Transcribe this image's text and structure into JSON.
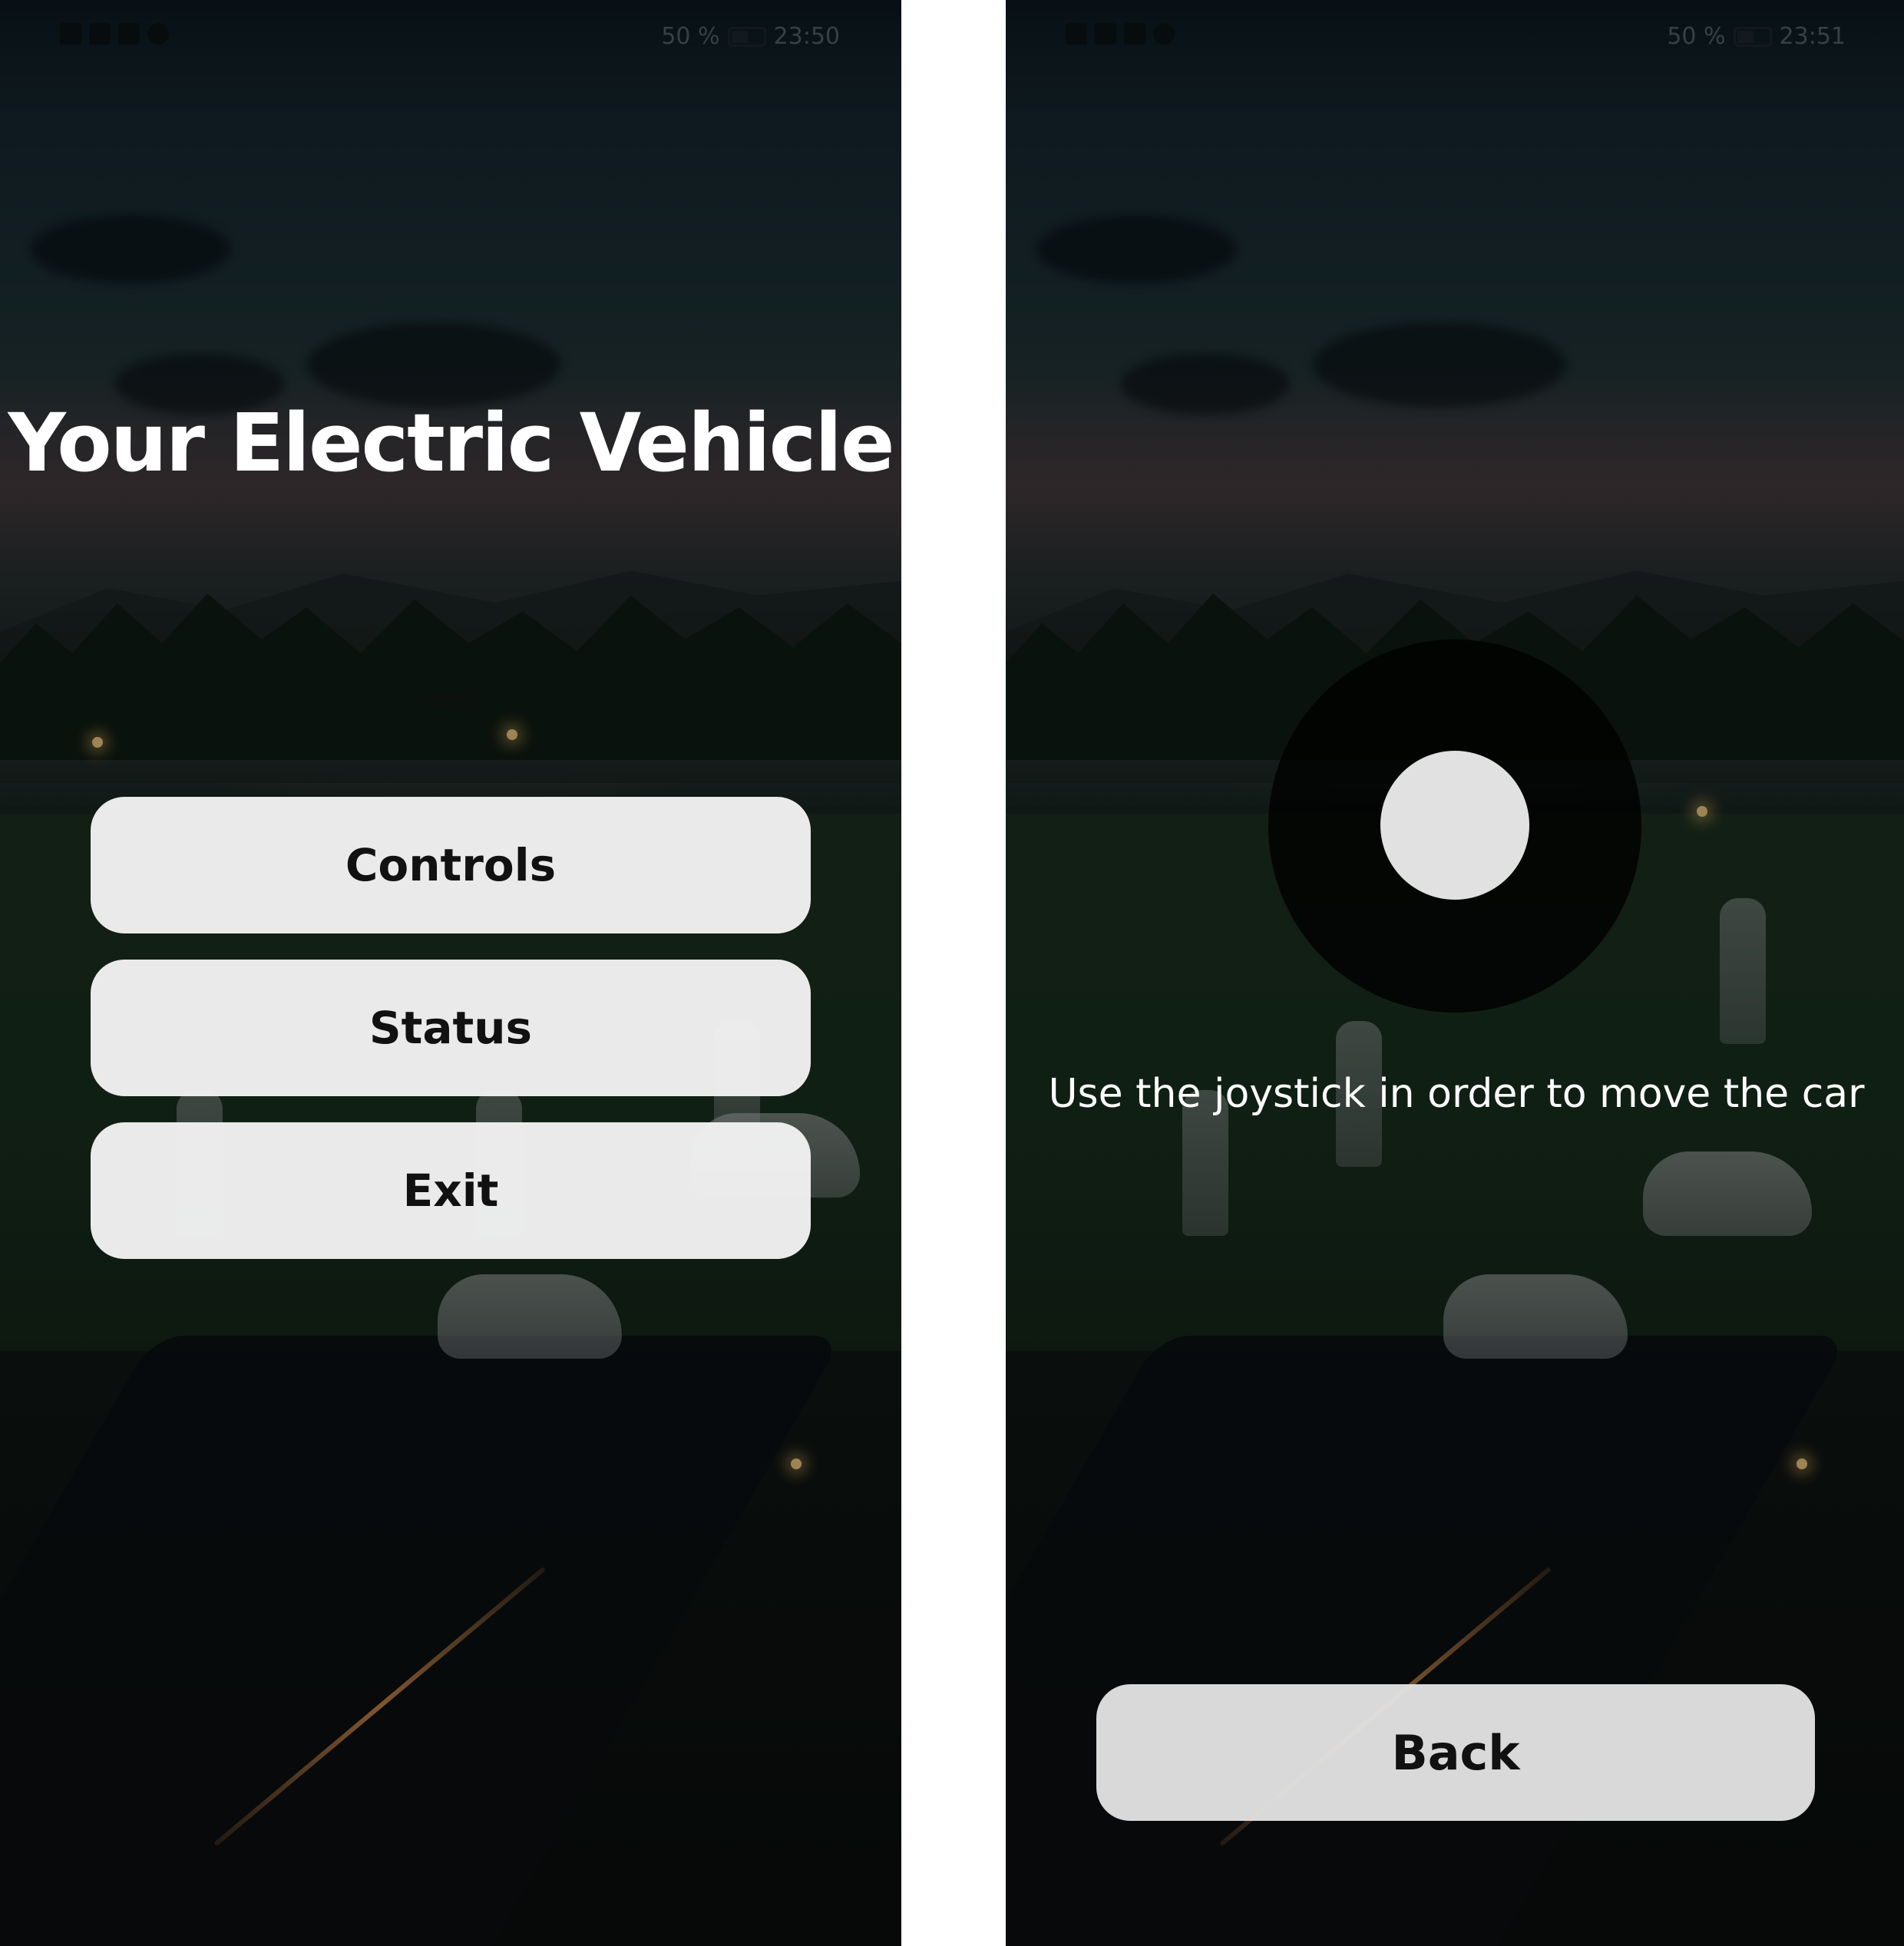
{
  "screens": {
    "menu": {
      "status_bar": {
        "battery": "50 %",
        "time": "23:50"
      },
      "title": "Your Electric Vehicle",
      "buttons": [
        "Controls",
        "Status",
        "Exit"
      ]
    },
    "controls": {
      "status_bar": {
        "battery": "50 %",
        "time": "23:51"
      },
      "hint": "Use the joystick in order to move the car",
      "back_label": "Back"
    }
  },
  "icons": {
    "status_left": [
      "sim-icon",
      "wifi-icon",
      "mute-icon",
      "app-icon"
    ],
    "status_right": [
      "battery-icon"
    ]
  },
  "colors": {
    "button_bg": "#f2f2f2",
    "button_text": "#111111",
    "title_text": "#ffffff",
    "joystick_base": "#000000",
    "joystick_knob": "#e1e1e1"
  }
}
